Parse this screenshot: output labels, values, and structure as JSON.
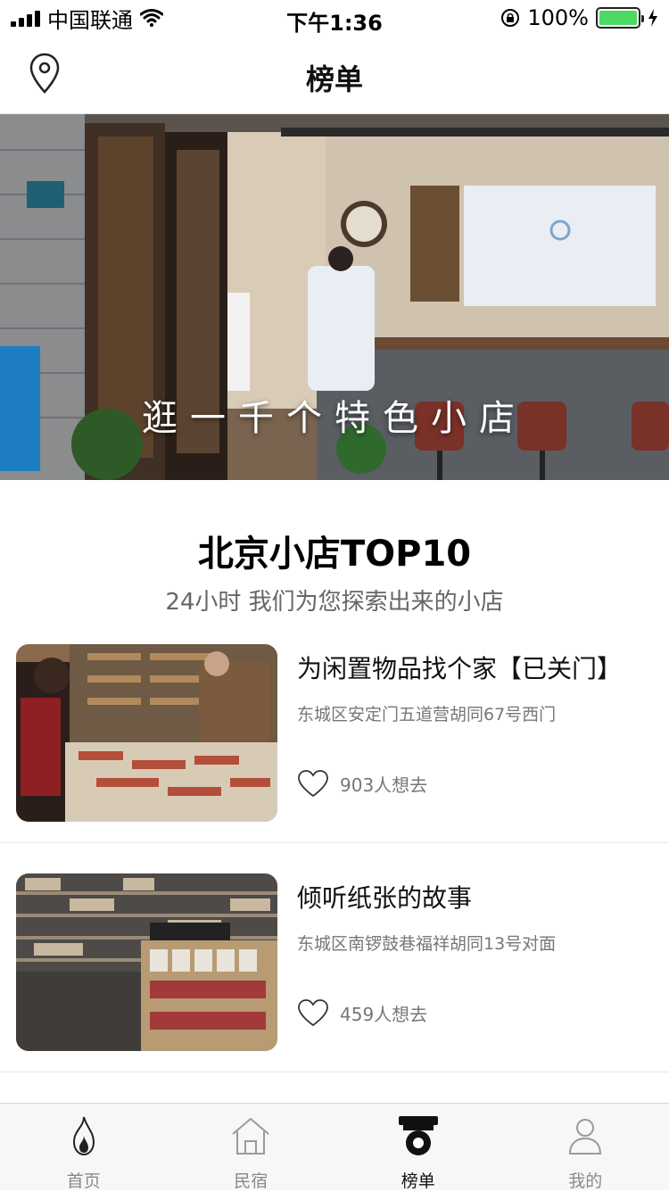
{
  "status_bar": {
    "carrier": "中国联通",
    "time": "下午1:36",
    "battery_level": "100%",
    "battery_fraction": 1.0
  },
  "nav": {
    "title": "榜单",
    "left_icon": "location-pin-icon"
  },
  "hero": {
    "caption": "逛一千个特色小店"
  },
  "section": {
    "title": "北京小店TOP10",
    "subtitle": "24小时 我们为您探索出来的小店"
  },
  "shops": [
    {
      "name": "为闲置物品找个家【已关门】",
      "address": "东城区安定门五道营胡同67号西门",
      "likes": "903人想去"
    },
    {
      "name": "倾听纸张的故事",
      "address": "东城区南锣鼓巷福祥胡同13号对面",
      "likes": "459人想去"
    }
  ],
  "tabs": [
    {
      "label": "首页",
      "icon": "flame-icon",
      "active": false
    },
    {
      "label": "民宿",
      "icon": "house-icon",
      "active": false
    },
    {
      "label": "榜单",
      "icon": "rank-board-icon",
      "active": true
    },
    {
      "label": "我的",
      "icon": "user-icon",
      "active": false
    }
  ],
  "colors": {
    "battery_green": "#4cd964",
    "text_primary": "#111111",
    "text_secondary": "#777777",
    "tab_inactive": "#8a8a8a"
  }
}
